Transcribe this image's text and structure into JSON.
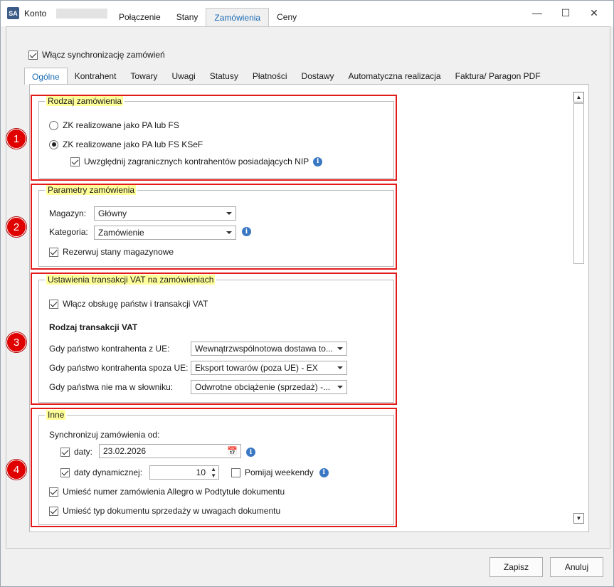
{
  "window": {
    "app_icon": "SA",
    "title": "Konto",
    "top_tabs": [
      {
        "label": "Połączenie",
        "active": false
      },
      {
        "label": "Stany",
        "active": false
      },
      {
        "label": "Zamówienia",
        "active": true
      },
      {
        "label": "Ceny",
        "active": false
      }
    ],
    "controls": {
      "minimize": "—",
      "maximize": "☐",
      "close": "✕"
    }
  },
  "sync": {
    "label": "Włącz synchronizację zamówień",
    "checked": true
  },
  "tabs": [
    {
      "label": "Ogólne",
      "active": true
    },
    {
      "label": "Kontrahent"
    },
    {
      "label": "Towary"
    },
    {
      "label": "Uwagi"
    },
    {
      "label": "Statusy"
    },
    {
      "label": "Płatności"
    },
    {
      "label": "Dostawy"
    },
    {
      "label": "Automatyczna realizacja"
    },
    {
      "label": "Faktura/ Paragon PDF"
    }
  ],
  "badges": [
    "1",
    "2",
    "3",
    "4"
  ],
  "section1": {
    "title": "Rodzaj zamówienia",
    "radio1": "ZK realizowane jako PA lub FS",
    "radio2": "ZK realizowane jako PA lub FS KSeF",
    "checkbox": "Uwzględnij zagranicznych kontrahentów posiadających NIP"
  },
  "section2": {
    "title": "Parametry zamówienia",
    "magazyn_label": "Magazyn:",
    "magazyn_value": "Główny",
    "kategoria_label": "Kategoria:",
    "kategoria_value": "Zamówienie",
    "rezerwuj": "Rezerwuj stany magazynowe"
  },
  "section3": {
    "title": "Ustawienia transakcji VAT na zamówieniach",
    "enable": "Włącz obsługę państw i transakcji VAT",
    "subheading": "Rodzaj transakcji VAT",
    "row1_label": "Gdy państwo kontrahenta z UE:",
    "row1_value": "Wewnątrzwspólnotowa dostawa to...",
    "row2_label": "Gdy państwo kontrahenta spoza UE:",
    "row2_value": "Eksport towarów (poza UE) - EX",
    "row3_label": "Gdy państwa nie ma w słowniku:",
    "row3_value": "Odwrotne obciążenie (sprzedaż) -..."
  },
  "section4": {
    "title": "Inne",
    "sync_from": "Synchronizuj zamówienia od:",
    "daty_label": "daty:",
    "daty_value": "23.02.2026",
    "dyn_label": "daty dynamicznej:",
    "dyn_value": "10",
    "pomijaj": "Pomijaj weekendy",
    "allegro": "Umieść numer zamówienia Allegro w Podtytule dokumentu",
    "typ": "Umieść typ dokumentu sprzedaży w uwagach dokumentu"
  },
  "buttons": {
    "save": "Zapisz",
    "cancel": "Anuluj"
  }
}
